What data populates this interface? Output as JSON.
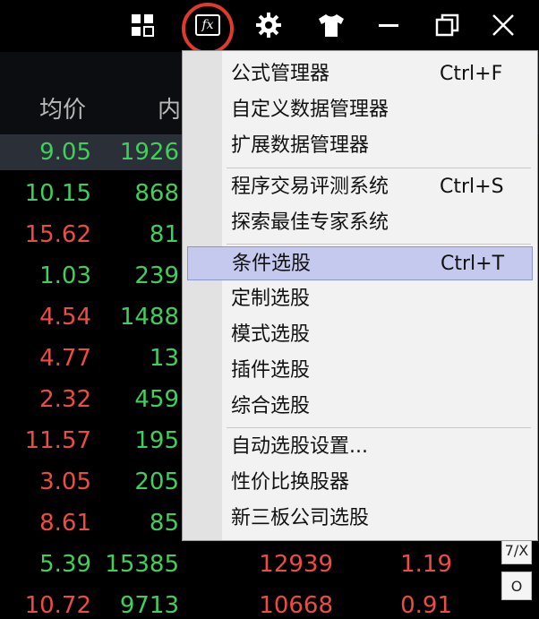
{
  "titlebar": {
    "icons": [
      "grid-icon",
      "fx-icon",
      "gear-icon",
      "shirt-icon",
      "minimize-icon",
      "restore-icon",
      "close-icon"
    ],
    "fx_label": "fx"
  },
  "table": {
    "headers": [
      "均价",
      "内"
    ],
    "rows": [
      {
        "c1": "9.05",
        "c2": "1926",
        "c3": "",
        "c4": "",
        "color1": "green",
        "color2": "green"
      },
      {
        "c1": "10.15",
        "c2": "868",
        "c3": "",
        "c4": "",
        "color1": "green",
        "color2": "green"
      },
      {
        "c1": "15.62",
        "c2": "81",
        "c3": "",
        "c4": "",
        "color1": "red",
        "color2": "green"
      },
      {
        "c1": "1.03",
        "c2": "239",
        "c3": "",
        "c4": "",
        "color1": "green",
        "color2": "green"
      },
      {
        "c1": "4.54",
        "c2": "1488",
        "c3": "",
        "c4": "",
        "color1": "red",
        "color2": "green"
      },
      {
        "c1": "4.77",
        "c2": "13",
        "c3": "",
        "c4": "",
        "color1": "red",
        "color2": "green"
      },
      {
        "c1": "2.32",
        "c2": "459",
        "c3": "",
        "c4": "",
        "color1": "red",
        "color2": "green"
      },
      {
        "c1": "11.57",
        "c2": "195",
        "c3": "",
        "c4": "",
        "color1": "red",
        "color2": "green"
      },
      {
        "c1": "3.05",
        "c2": "205",
        "c3": "",
        "c4": "",
        "color1": "red",
        "color2": "green"
      },
      {
        "c1": "8.61",
        "c2": "85",
        "c3": "",
        "c4": "",
        "color1": "red",
        "color2": "green"
      },
      {
        "c1": "5.39",
        "c2": "15385",
        "c3": "12939",
        "c4": "1.19",
        "color1": "green",
        "color2": "green"
      },
      {
        "c1": "10.72",
        "c2": "9713",
        "c3": "10668",
        "c4": "0.91",
        "color1": "red",
        "color2": "green"
      }
    ]
  },
  "menu": {
    "items": [
      {
        "label": "公式管理器",
        "shortcut": "Ctrl+F"
      },
      {
        "label": "自定义数据管理器",
        "shortcut": ""
      },
      {
        "label": "扩展数据管理器",
        "shortcut": ""
      },
      {
        "label": "程序交易评测系统",
        "shortcut": "Ctrl+S"
      },
      {
        "label": "探索最佳专家系统",
        "shortcut": ""
      },
      {
        "label": "条件选股",
        "shortcut": "Ctrl+T"
      },
      {
        "label": "定制选股",
        "shortcut": ""
      },
      {
        "label": "模式选股",
        "shortcut": ""
      },
      {
        "label": "插件选股",
        "shortcut": ""
      },
      {
        "label": "综合选股",
        "shortcut": ""
      },
      {
        "label": "自动选股设置...",
        "shortcut": ""
      },
      {
        "label": "性价比换股器",
        "shortcut": ""
      },
      {
        "label": "新三板公司选股",
        "shortcut": ""
      }
    ]
  },
  "side": {
    "btn1": "7/X",
    "btn2": "O"
  },
  "colors": {
    "green": "#3fcf5b",
    "red": "#ee4b44",
    "highlight": "#c5c9ee",
    "ring": "#e03a2d"
  }
}
